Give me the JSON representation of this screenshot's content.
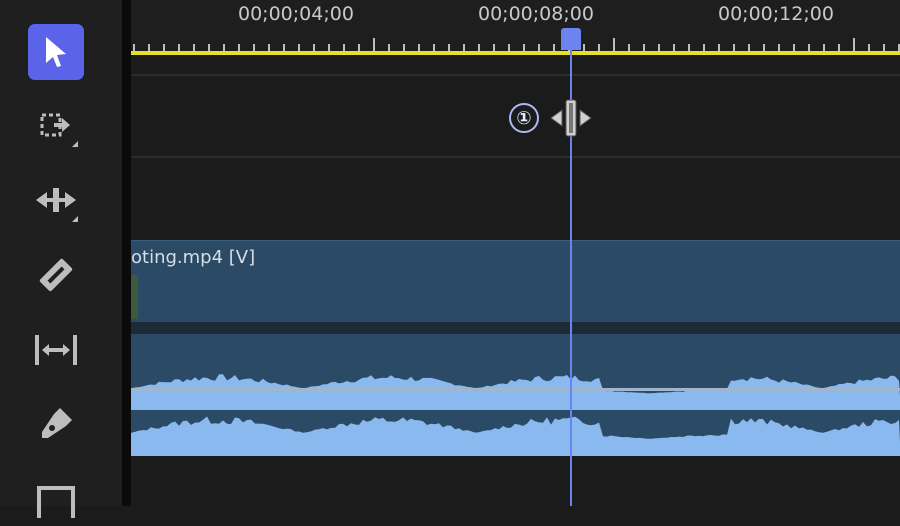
{
  "toolbar": {
    "tools": [
      {
        "name": "selection-tool",
        "active": true
      },
      {
        "name": "track-select-forward-tool",
        "active": false
      },
      {
        "name": "ripple-edit-tool",
        "active": false
      },
      {
        "name": "razor-tool",
        "active": false
      },
      {
        "name": "slip-tool",
        "active": false
      },
      {
        "name": "pen-tool",
        "active": false
      },
      {
        "name": "rectangle-tool",
        "active": false
      }
    ]
  },
  "timeline": {
    "timecodes": [
      "00;00;04;00",
      "00;00;08;00",
      "00;00;12;00"
    ],
    "video_clip_label": "oting.mp4 [V]",
    "annotation_badge": "①"
  },
  "colors": {
    "active_tool": "#5b63e8",
    "playhead": "#6d83f0",
    "work_area_bar": "#e7e02a",
    "clip": "#2a4a66",
    "waveform": "#8ab9f0"
  }
}
